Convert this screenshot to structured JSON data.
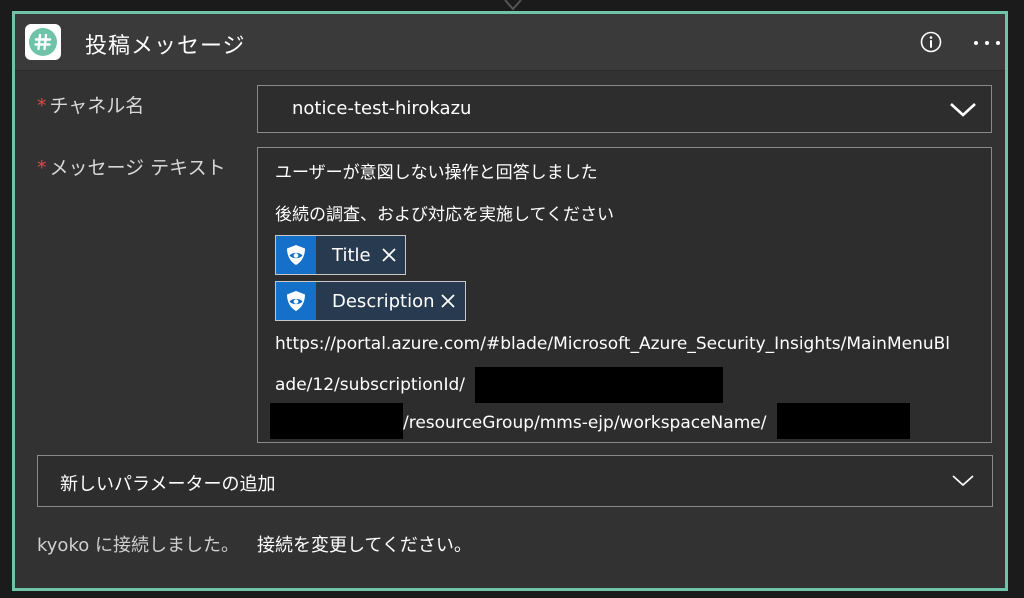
{
  "header": {
    "title": "投稿メッセージ"
  },
  "channel": {
    "label": "チャネル名",
    "required_mark": "*",
    "value": "notice-test-hirokazu"
  },
  "message": {
    "label": "メッセージ テキスト",
    "required_mark": "*",
    "line1": "ユーザーが意図しない操作と回答しました",
    "line2": "後続の調査、および対応を実施してください",
    "tokens": [
      {
        "label": "Title"
      },
      {
        "label": "Description"
      }
    ],
    "url_line1": "https://portal.azure.com/#blade/Microsoft_Azure_Security_Insights/MainMenuBl",
    "url_line2": "ade/12/subscriptionId/",
    "url_line3": "/resourceGroup/mms-ejp/workspaceName/"
  },
  "add_parameter": {
    "label": "新しいパラメーターの追加"
  },
  "footer": {
    "connected_text": "kyoko に接続しました。",
    "change_link": "接続を変更してください。"
  },
  "colors": {
    "accent": "#6fc3a8",
    "required": "#e04848",
    "token_icon_bg": "#1470c8"
  }
}
